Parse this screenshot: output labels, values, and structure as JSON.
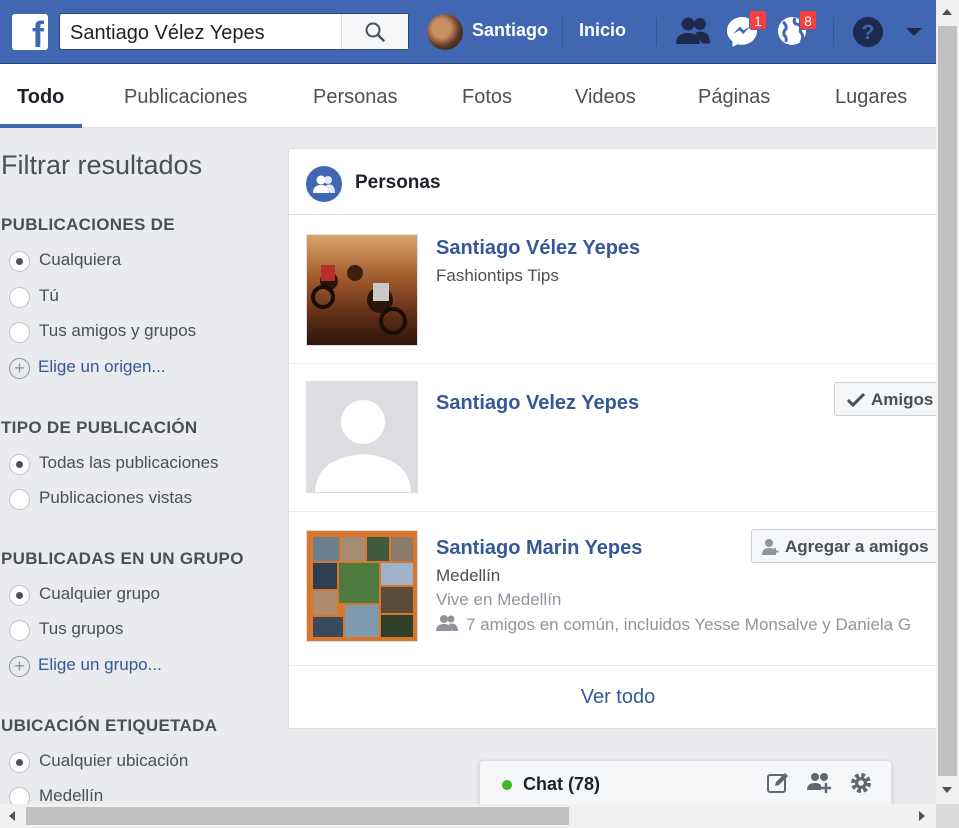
{
  "topbar": {
    "logo_letter": "f",
    "search_value": "Santiago Vélez Yepes",
    "user_name": "Santiago",
    "home_label": "Inicio",
    "messages_badge": "1",
    "notifications_badge": "8",
    "help_icon": "question-circle-icon",
    "menu_icon": "caret-down-icon",
    "brand_color": "#4267b2"
  },
  "tabs": [
    {
      "label": "Todo",
      "active": true
    },
    {
      "label": "Publicaciones"
    },
    {
      "label": "Personas"
    },
    {
      "label": "Fotos"
    },
    {
      "label": "Videos"
    },
    {
      "label": "Páginas"
    },
    {
      "label": "Lugares"
    }
  ],
  "sidebar": {
    "title": "Filtrar resultados",
    "sections": [
      {
        "heading": "PUBLICACIONES DE",
        "options": [
          "Cualquiera",
          "Tú",
          "Tus amigos y grupos"
        ],
        "selected": "Cualquiera",
        "link": "Elige un origen..."
      },
      {
        "heading": "TIPO DE PUBLICACIÓN",
        "options": [
          "Todas las publicaciones",
          "Publicaciones vistas"
        ],
        "selected": "Todas las publicaciones"
      },
      {
        "heading": "PUBLICADAS EN UN GRUPO",
        "options": [
          "Cualquier grupo",
          "Tus grupos"
        ],
        "selected": "Cualquier grupo",
        "link": "Elige un grupo..."
      },
      {
        "heading": "UBICACIÓN ETIQUETADA",
        "options": [
          "Cualquier ubicación",
          "Medellín"
        ],
        "selected": "Cualquier ubicación"
      }
    ]
  },
  "results": {
    "title": "Personas",
    "people": [
      {
        "name": "Santiago Vélez Yepes",
        "meta": [
          "Fashiontips Tips"
        ]
      },
      {
        "name": "Santiago Velez Yepes",
        "meta": [],
        "button": "Amigos"
      },
      {
        "name": "Santiago Marin Yepes",
        "meta": [
          "Medellín",
          "Vive en Medellín",
          "7 amigos en común, incluidos Yesse Monsalve y Daniela G"
        ],
        "button": "Agregar a amigos"
      }
    ],
    "see_all": "Ver todo"
  },
  "chat": {
    "label": "Chat (78)",
    "status_color": "#42b72a"
  }
}
